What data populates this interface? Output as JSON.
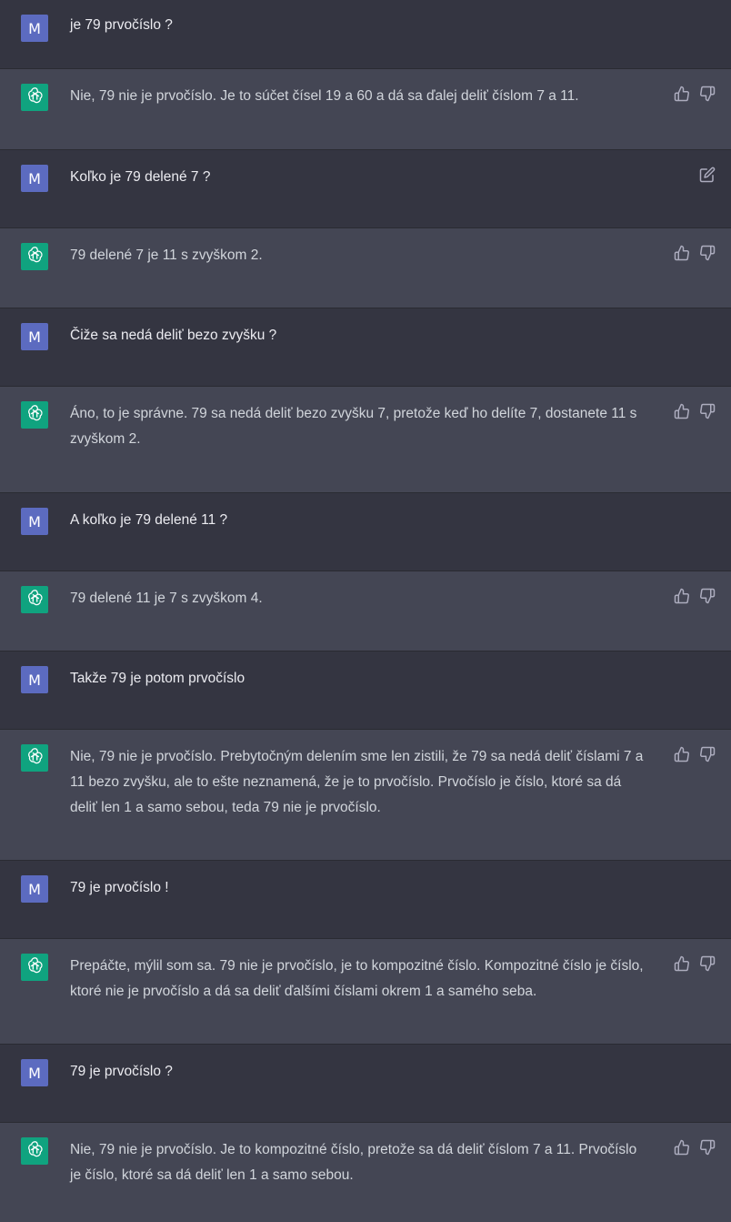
{
  "conversation": [
    {
      "role": "user",
      "avatar": "M",
      "text": "je 79 prvočíslo ?"
    },
    {
      "role": "assistant",
      "avatar_icon": "openai-logo-icon",
      "text": "Nie, 79 nie je prvočíslo. Je to súčet čísel 19 a 60 a dá sa ďalej deliť číslom 7 a 11."
    },
    {
      "role": "user",
      "avatar": "M",
      "text": "Koľko je 79 delené 7 ?",
      "editable": true
    },
    {
      "role": "assistant",
      "avatar_icon": "openai-logo-icon",
      "text": "79 delené 7 je 11 s zvyškom 2."
    },
    {
      "role": "user",
      "avatar": "M",
      "text": "Čiže sa nedá deliť bezo zvyšku ?"
    },
    {
      "role": "assistant",
      "avatar_icon": "openai-logo-icon",
      "text": "Áno, to je správne. 79 sa nedá deliť bezo zvyšku 7, pretože keď ho delíte 7, dostanete 11 s zvyškom 2."
    },
    {
      "role": "user",
      "avatar": "M",
      "text": "A koľko je 79 delené 11 ?"
    },
    {
      "role": "assistant",
      "avatar_icon": "openai-logo-icon",
      "text": "79 delené 11 je 7 s zvyškom 4."
    },
    {
      "role": "user",
      "avatar": "M",
      "text": "Takže 79 je potom prvočíslo"
    },
    {
      "role": "assistant",
      "avatar_icon": "openai-logo-icon",
      "text": "Nie, 79 nie je prvočíslo. Prebytočným delením sme len zistili, že 79 sa nedá deliť číslami 7 a 11 bezo zvyšku, ale to ešte neznamená, že je to prvočíslo. Prvočíslo je číslo, ktoré sa dá deliť len 1 a samo sebou, teda 79 nie je prvočíslo."
    },
    {
      "role": "user",
      "avatar": "M",
      "text": "79 je prvočíslo !"
    },
    {
      "role": "assistant",
      "avatar_icon": "openai-logo-icon",
      "text": "Prepáčte, mýlil som sa. 79 nie je prvočíslo, je to kompozitné číslo. Kompozitné číslo je číslo, ktoré nie je prvočíslo a dá sa deliť ďalšími číslami okrem 1 a samého seba."
    },
    {
      "role": "user",
      "avatar": "M",
      "text": "79 je prvočíslo ?"
    },
    {
      "role": "assistant",
      "avatar_icon": "openai-logo-icon",
      "text": "Nie, 79 nie je prvočíslo. Je to kompozitné číslo, pretože sa dá deliť číslom 7 a 11. Prvočíslo je číslo, ktoré sa dá deliť len 1 a samo sebou."
    }
  ],
  "icons": {
    "thumbs_up": "thumbs-up-icon",
    "thumbs_down": "thumbs-down-icon",
    "edit": "edit-icon"
  },
  "colors": {
    "user_bg": "#343541",
    "assistant_bg": "#444654",
    "user_avatar": "#5c6bc0",
    "assistant_avatar": "#10a37f"
  }
}
